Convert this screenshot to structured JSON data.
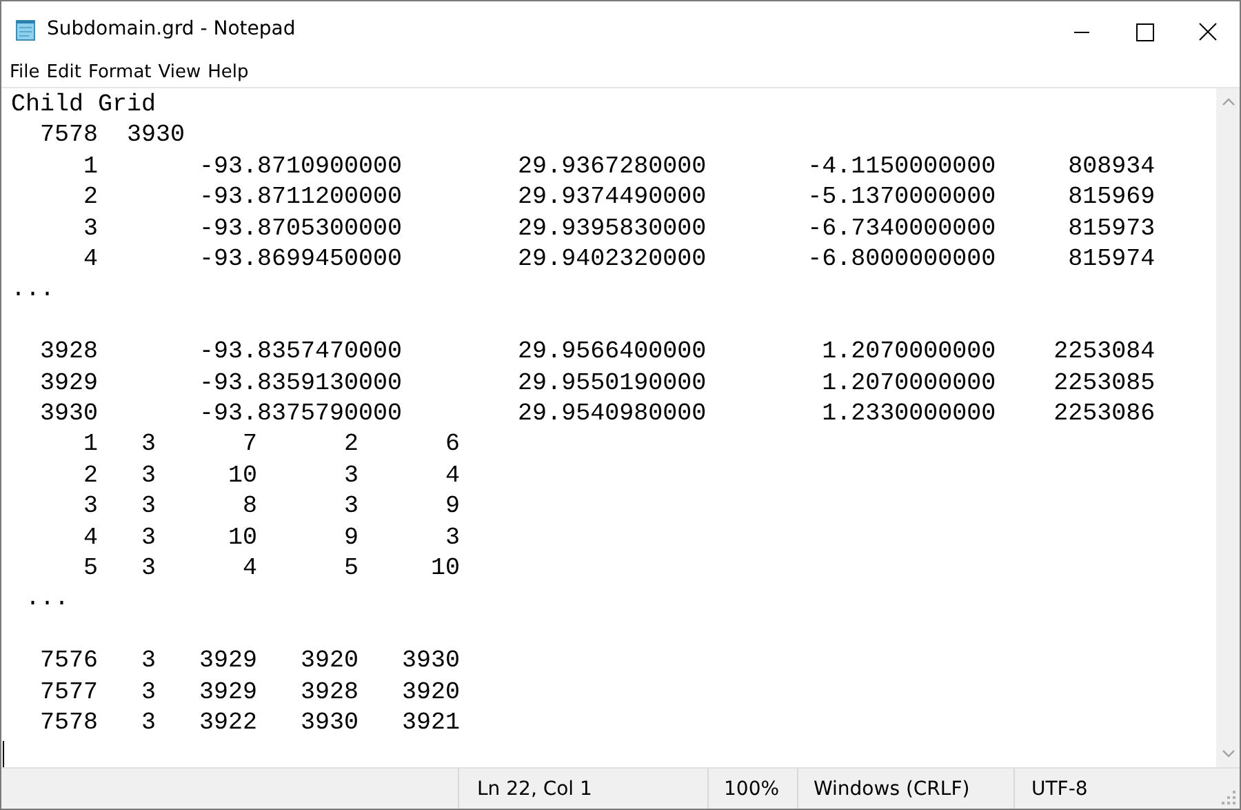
{
  "window": {
    "title": "Subdomain.grd - Notepad"
  },
  "menu": [
    "File",
    "Edit",
    "Format",
    "View",
    "Help"
  ],
  "editor": {
    "blocks": [
      [
        "Child Grid",
        "  7578  3930",
        "     1       -93.8710900000        29.9367280000       -4.1150000000     808934",
        "     2       -93.8711200000        29.9374490000       -5.1370000000     815969",
        "     3       -93.8705300000        29.9395830000       -6.7340000000     815973",
        "     4       -93.8699450000        29.9402320000       -6.8000000000     815974",
        "..."
      ],
      [
        "  3928       -93.8357470000        29.9566400000        1.2070000000    2253084",
        "  3929       -93.8359130000        29.9550190000        1.2070000000    2253085",
        "  3930       -93.8375790000        29.9540980000        1.2330000000    2253086",
        "     1   3      7      2      6",
        "     2   3     10      3      4",
        "     3   3      8      3      9",
        "     4   3     10      9      3",
        "     5   3      4      5     10",
        " ..."
      ],
      [
        "  7576   3   3929   3920   3930",
        "  7577   3   3929   3928   3920",
        "  7578   3   3922   3930   3921"
      ]
    ]
  },
  "status_bar": [
    "Ln 22, Col 1",
    "100%",
    "Windows (CRLF)",
    "UTF-8"
  ]
}
